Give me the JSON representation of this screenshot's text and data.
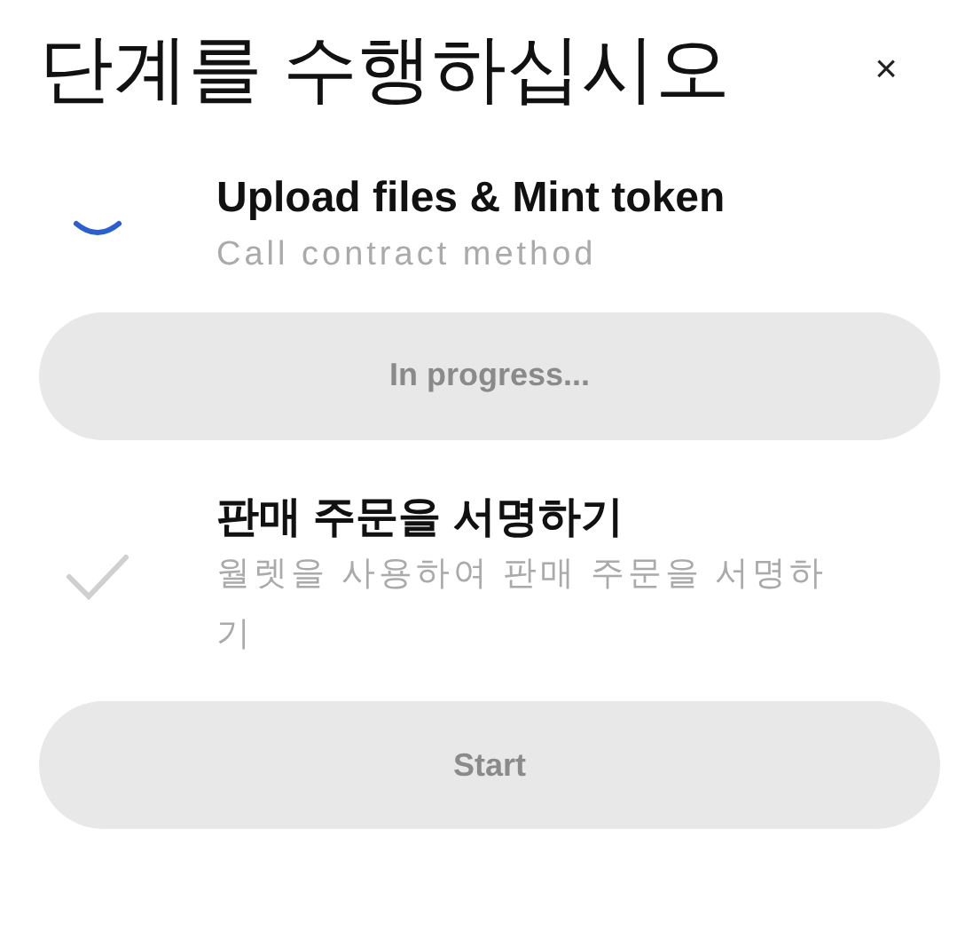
{
  "dialog": {
    "title": "단계를 수행하십시오",
    "close": "×"
  },
  "steps": [
    {
      "title": "Upload files & Mint token",
      "description": "Call contract method",
      "kind": "spinner",
      "button": {
        "label": "In progress...",
        "disabled": true
      }
    },
    {
      "title": "판매 주문을 서명하기",
      "description": "월렛을 사용하여 판매 주문을 서명하기",
      "kind": "check",
      "button": {
        "label": "Start",
        "disabled": true
      }
    }
  ]
}
